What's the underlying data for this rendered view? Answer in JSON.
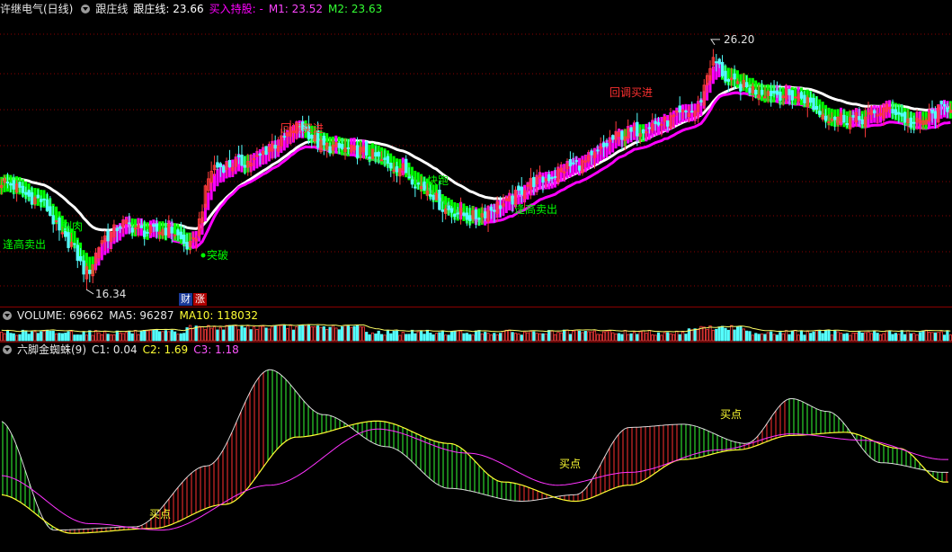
{
  "main": {
    "stock": "许继电气(日线)",
    "indicator_name": "跟庄线",
    "line_label": "跟庄线: 23.66",
    "buy_hold_label": "买入持股: -",
    "m1_label": "M1: 23.52",
    "m2_label": "M2: 23.63",
    "high_label": "26.20",
    "low_label": "16.34",
    "badges": [
      "财",
      "涨"
    ],
    "annotations": {
      "sell_high_1": "逢高卖出",
      "cut_meat": "割肉",
      "breakout": "突破",
      "pullback_buy_1": "回调买进",
      "quick_run": "快跑",
      "sell_high_2": "逢高卖出",
      "pullback_buy_2": "回调买进"
    }
  },
  "volume": {
    "label": "VOLUME: 69662",
    "ma5_label": "MA5: 96287",
    "ma10_label": "MA10: 118032"
  },
  "spider": {
    "name": "六脚金蜘蛛(9)",
    "c1_label": "C1: 0.04",
    "c2_label": "C2: 1.69",
    "c3_label": "C3: 1.18",
    "buy_labels": [
      "买点",
      "买点",
      "买点"
    ]
  },
  "colors": {
    "bg": "#000000",
    "up": "#ff3b3b",
    "down": "#54ffff",
    "white_line": "#ffffff",
    "magenta": "#ff00ff",
    "green": "#00ff00",
    "yellow": "#ffff00",
    "grid": "#8b0000"
  },
  "chart_data": [
    {
      "type": "candlestick",
      "title": "许继电气(日线)",
      "ylim": [
        15.8,
        27.2
      ],
      "low": 16.34,
      "high": 26.2,
      "close_anchors": [
        [
          0,
          20.6
        ],
        [
          12,
          19.9
        ],
        [
          22,
          18.2
        ],
        [
          28,
          17.0
        ],
        [
          34,
          18.4
        ],
        [
          40,
          18.9
        ],
        [
          48,
          18.6
        ],
        [
          55,
          18.7
        ],
        [
          62,
          18.0
        ],
        [
          70,
          21.2
        ],
        [
          82,
          21.4
        ],
        [
          90,
          22.1
        ],
        [
          98,
          22.8
        ],
        [
          106,
          22.0
        ],
        [
          118,
          21.8
        ],
        [
          130,
          21.2
        ],
        [
          140,
          20.3
        ],
        [
          146,
          19.5
        ],
        [
          155,
          19.2
        ],
        [
          165,
          19.7
        ],
        [
          175,
          20.6
        ],
        [
          190,
          21.3
        ],
        [
          205,
          22.5
        ],
        [
          215,
          22.9
        ],
        [
          228,
          23.4
        ],
        [
          234,
          25.4
        ],
        [
          240,
          24.5
        ],
        [
          250,
          24.2
        ],
        [
          262,
          24.0
        ],
        [
          272,
          23.2
        ],
        [
          282,
          23.1
        ],
        [
          292,
          23.5
        ],
        [
          300,
          22.9
        ],
        [
          312,
          23.6
        ]
      ],
      "series": [
        {
          "name": "跟庄线",
          "last": 23.66
        },
        {
          "name": "M1",
          "last": 23.52
        },
        {
          "name": "M2",
          "last": 23.63
        }
      ],
      "annotations": [
        "逢高卖出",
        "割肉",
        "突破",
        "回调买进",
        "快跑",
        "逢高卖出",
        "回调买进"
      ]
    },
    {
      "type": "bar",
      "title": "VOLUME",
      "last": 69662,
      "ma5": 96287,
      "ma10": 118032
    },
    {
      "type": "area",
      "title": "六脚金蜘蛛(9)",
      "ylim": [
        -3,
        3
      ],
      "series": [
        {
          "name": "C1",
          "last": 0.04
        },
        {
          "name": "C2",
          "last": 1.69
        },
        {
          "name": "C3",
          "last": 1.18
        }
      ],
      "c2_anchors": [
        [
          0,
          1.0
        ],
        [
          60,
          -2.4
        ],
        [
          150,
          -2.3
        ],
        [
          230,
          -0.4
        ],
        [
          300,
          2.6
        ],
        [
          360,
          1.2
        ],
        [
          430,
          0.2
        ],
        [
          500,
          -1.1
        ],
        [
          580,
          -1.5
        ],
        [
          640,
          -1.3
        ],
        [
          700,
          0.8
        ],
        [
          760,
          0.9
        ],
        [
          830,
          0.3
        ],
        [
          880,
          1.7
        ],
        [
          920,
          1.3
        ],
        [
          980,
          -0.3
        ],
        [
          1050,
          -0.6
        ]
      ],
      "c1_anchors": [
        [
          0,
          -1.3
        ],
        [
          80,
          -2.5
        ],
        [
          170,
          -2.35
        ],
        [
          250,
          -1.6
        ],
        [
          330,
          0.5
        ],
        [
          420,
          1.0
        ],
        [
          500,
          0.3
        ],
        [
          560,
          -0.9
        ],
        [
          640,
          -1.5
        ],
        [
          700,
          -1.0
        ],
        [
          760,
          -0.2
        ],
        [
          820,
          0.1
        ],
        [
          880,
          0.55
        ],
        [
          940,
          0.65
        ],
        [
          1000,
          0.15
        ],
        [
          1050,
          -0.9
        ]
      ],
      "c3_anchors": [
        [
          0,
          -0.7
        ],
        [
          100,
          -2.2
        ],
        [
          180,
          -2.4
        ],
        [
          300,
          -1.0
        ],
        [
          420,
          0.75
        ],
        [
          520,
          0.0
        ],
        [
          620,
          -1.0
        ],
        [
          700,
          -0.6
        ],
        [
          800,
          0.1
        ],
        [
          880,
          0.6
        ],
        [
          960,
          0.4
        ],
        [
          1050,
          -0.2
        ]
      ],
      "annotations": [
        "买点",
        "买点",
        "买点"
      ]
    }
  ]
}
